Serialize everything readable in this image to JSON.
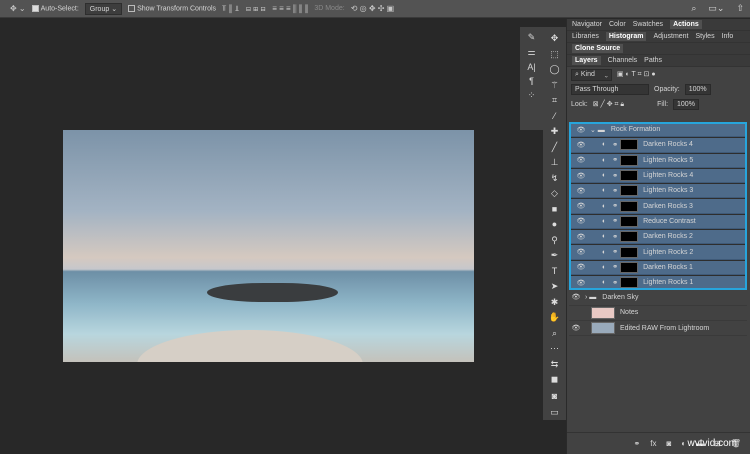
{
  "options_bar": {
    "auto_select_label": "Auto-Select:",
    "auto_select_value": "Group",
    "show_transform_label": "Show Transform Controls",
    "mode_3d_label": "3D Mode:"
  },
  "panels": {
    "tabs_row1": [
      "Navigator",
      "Color",
      "Swatches",
      "Actions"
    ],
    "tabs_row2": [
      "Libraries",
      "Histogram",
      "Adjustment",
      "Styles",
      "Info"
    ],
    "tabs_row3": [
      "Clone Source"
    ],
    "tabs_row4": [
      "Layers",
      "Channels",
      "Paths"
    ]
  },
  "layers_panel": {
    "filter": "Kind",
    "blend_mode": "Pass Through",
    "opacity_label": "Opacity:",
    "opacity": "100%",
    "lock_label": "Lock:",
    "fill_label": "Fill:",
    "fill": "100%",
    "group": "Rock Formation",
    "group_layers": [
      "Darken Rocks 4",
      "Lighten Rocks 5",
      "Lighten Rocks 4",
      "Lighten Rocks 3",
      "Darken Rocks 3",
      "Reduce Contrast",
      "Darken Rocks 2",
      "Lighten Rocks 2",
      "Darken Rocks 1",
      "Lighten Rocks 1"
    ],
    "other_layers": [
      "Darken Sky",
      "Notes",
      "Edited RAW From Lightroom"
    ]
  },
  "watermark": "wvtvid.com",
  "colors": {
    "selection": "#27a5dc",
    "selected_row": "#4e6b8a"
  }
}
